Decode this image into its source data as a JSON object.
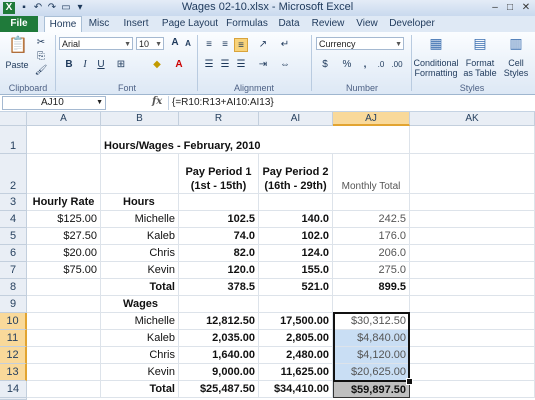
{
  "window": {
    "title": "Wages 02-10.xlsx - Microsoft Excel"
  },
  "tabs": [
    "File",
    "Home",
    "Misc",
    "Insert",
    "Page Layout",
    "Formulas",
    "Data",
    "Review",
    "View",
    "Developer"
  ],
  "ribbon": {
    "clipboard": {
      "paste": "Paste",
      "label": "Clipboard"
    },
    "font": {
      "name": "Arial",
      "size": "10",
      "label": "Font",
      "grow": "A",
      "shrink": "A"
    },
    "alignment": {
      "label": "Alignment"
    },
    "number": {
      "format": "Currency",
      "label": "Number"
    },
    "styles": {
      "label": "Styles",
      "conditional": "Conditional",
      "conditional2": "Formatting",
      "format_table": "Format",
      "format_table2": "as Table",
      "cell_styles": "Cell",
      "cell_styles2": "Styles"
    }
  },
  "formula_bar": {
    "name_box": "AJ10",
    "fx": "fx",
    "formula": "{=R10:R13+AI10:AI13}"
  },
  "grid": {
    "columns": [
      "A",
      "B",
      "R",
      "AI",
      "AJ",
      "AK"
    ],
    "rows": [
      "1",
      "2",
      "3",
      "4",
      "5",
      "6",
      "7",
      "8",
      "9",
      "10",
      "11",
      "12",
      "13",
      "14"
    ],
    "cells": {
      "B1": "Hours/Wages - February, 2010",
      "R2a": "Pay Period 1",
      "R2b": "(1st - 15th)",
      "AI2a": "Pay Period 2",
      "AI2b": "(16th - 29th)",
      "AJ2": "Monthly Total",
      "A3": "Hourly Rate",
      "B3": "Hours",
      "A4": "$125.00",
      "B4": "Michelle",
      "R4": "102.5",
      "AI4": "140.0",
      "AJ4": "242.5",
      "A5": "$27.50",
      "B5": "Kaleb",
      "R5": "74.0",
      "AI5": "102.0",
      "AJ5": "176.0",
      "A6": "$20.00",
      "B6": "Chris",
      "R6": "82.0",
      "AI6": "124.0",
      "AJ6": "206.0",
      "A7": "$75.00",
      "B7": "Kevin",
      "R7": "120.0",
      "AI7": "155.0",
      "AJ7": "275.0",
      "B8": "Total",
      "R8": "378.5",
      "AI8": "521.0",
      "AJ8": "899.5",
      "B9": "Wages",
      "B10": "Michelle",
      "R10": "12,812.50",
      "AI10": "17,500.00",
      "AJ10": "$30,312.50",
      "B11": "Kaleb",
      "R11": "2,035.00",
      "AI11": "2,805.00",
      "AJ11": "$4,840.00",
      "B12": "Chris",
      "R12": "1,640.00",
      "AI12": "2,480.00",
      "AJ12": "$4,120.00",
      "B13": "Kevin",
      "R13": "9,000.00",
      "AI13": "11,625.00",
      "AJ13": "$20,625.00",
      "B14": "Total",
      "R14": "$25,487.50",
      "AI14": "$34,410.00",
      "AJ14": "$59,897.50"
    }
  },
  "colors": {
    "file_tab": "#1f7a3a",
    "selection_highlight": "#c9def4",
    "header_selected": "#f9d99a",
    "total_cell": "#bfbfbf"
  }
}
